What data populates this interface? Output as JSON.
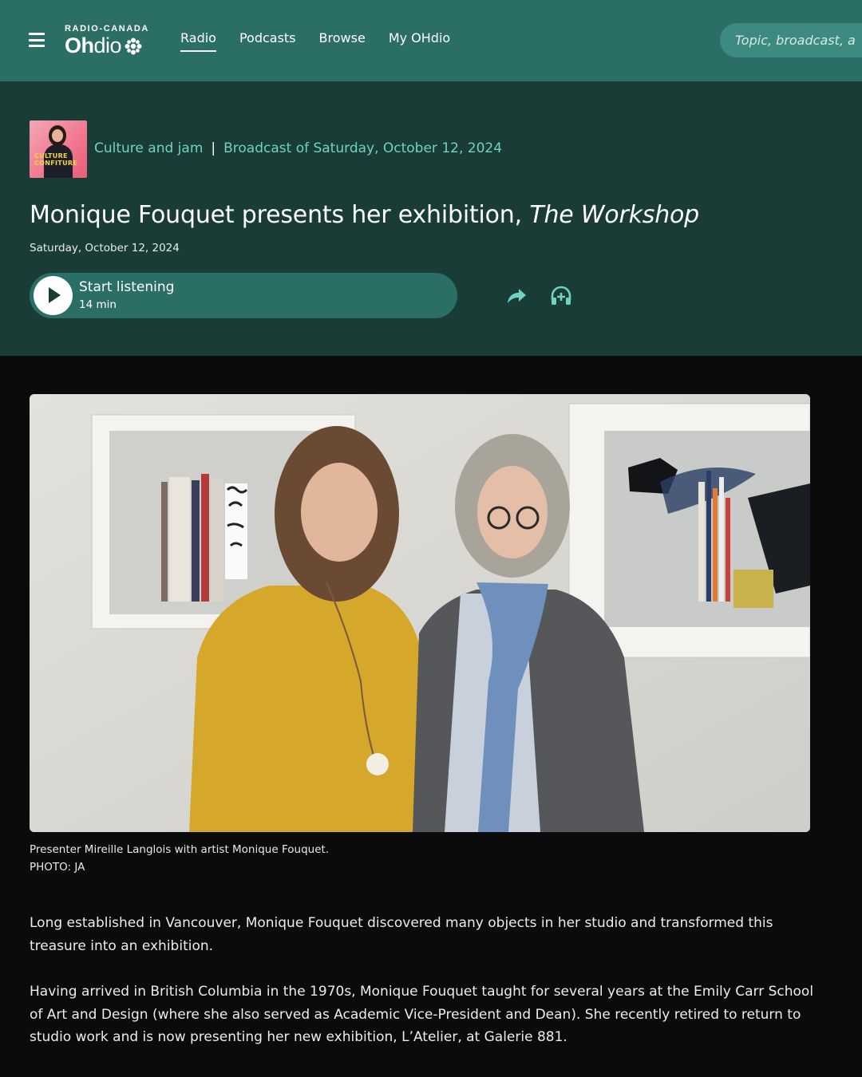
{
  "header": {
    "logo_top": "RADIO-CANADA",
    "logo_bold": "Oh",
    "logo_rest": "dio",
    "nav": [
      {
        "label": "Radio",
        "active": true
      },
      {
        "label": "Podcasts",
        "active": false
      },
      {
        "label": "Browse",
        "active": false
      },
      {
        "label": "My OHdio",
        "active": false
      }
    ],
    "search_placeholder": "Topic, broadcast, a"
  },
  "show": {
    "cover_text_1": "CULTURE",
    "cover_text_2": "CONFITURE",
    "name": "Culture and jam",
    "separator": "|",
    "broadcast": "Broadcast of Saturday, October 12, 2024"
  },
  "episode": {
    "title_main": "Monique Fouquet presents her exhibition, ",
    "title_italic": "The Workshop",
    "date": "Saturday, October 12, 2024",
    "listen_label": "Start listening",
    "duration": "14 min",
    "icons": {
      "play": "play-icon",
      "share": "share-icon",
      "add": "headphones-add-icon"
    }
  },
  "photo": {
    "caption": "Presenter Mireille Langlois with artist Monique Fouquet.",
    "credit": "PHOTO: JA"
  },
  "article": {
    "paragraphs": [
      "Long established in Vancouver, Monique Fouquet discovered many objects in her studio and transformed this treasure into an exhibition.",
      "Having arrived in British Columbia in the 1970s, Monique Fouquet taught for several years at the Emily Carr School of Art and Design (where she also served as Academic Vice-President and Dean). She recently retired to return to studio work and is now presenting her new exhibition, L’Atelier, at Galerie 881."
    ]
  },
  "colors": {
    "nav_bg": "#2b6e66",
    "band_bg": "#193c37",
    "accent": "#6fd3c2",
    "page_bg": "#0b0b0b"
  }
}
